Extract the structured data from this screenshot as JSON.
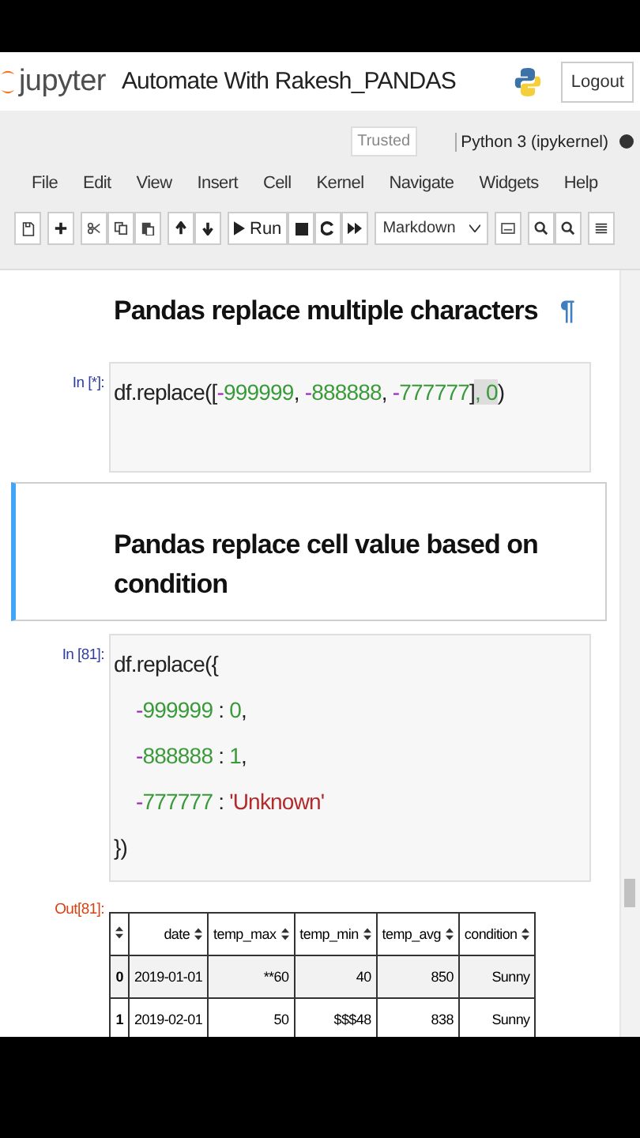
{
  "header": {
    "logo_text": "jupyter",
    "notebook_title": "Automate With Rakesh_PANDAS",
    "logout": "Logout"
  },
  "kernel_bar": {
    "trusted": "Trusted",
    "kernel": "Python 3 (ipykernel)",
    "busy": true
  },
  "menu": [
    "File",
    "Edit",
    "View",
    "Insert",
    "Cell",
    "Kernel",
    "Navigate",
    "Widgets",
    "Help"
  ],
  "toolbar": {
    "run": "Run",
    "cell_type": "Markdown"
  },
  "cells": [
    {
      "kind": "markdown",
      "selected": false,
      "heading": "Pandas replace multiple characters",
      "anchor": "¶"
    },
    {
      "kind": "code",
      "prompt": "In [*]:",
      "lines": [
        {
          "indented": false,
          "tokens": [
            {
              "kind": "name",
              "text": "df.replace(["
            },
            {
              "kind": "op",
              "text": "-"
            },
            {
              "kind": "num",
              "text": "999999"
            },
            {
              "kind": "name",
              "text": ", "
            },
            {
              "kind": "op",
              "text": "-"
            },
            {
              "kind": "num",
              "text": "888888"
            },
            {
              "kind": "name",
              "text": ", "
            },
            {
              "kind": "op",
              "text": "-"
            },
            {
              "kind": "num",
              "text": "777777"
            },
            {
              "kind": "name",
              "text": "]"
            },
            {
              "kind": "match",
              "text": ", 0"
            },
            {
              "kind": "name",
              "text": ")"
            }
          ]
        }
      ]
    },
    {
      "kind": "markdown",
      "selected": true,
      "heading": "Pandas replace cell value based on condition"
    },
    {
      "kind": "code",
      "prompt": "In [81]:",
      "lines": [
        {
          "indented": false,
          "tokens": [
            {
              "kind": "name",
              "text": "df.replace({"
            }
          ]
        },
        {
          "indented": true,
          "tokens": [
            {
              "kind": "op",
              "text": "-"
            },
            {
              "kind": "num",
              "text": "999999"
            },
            {
              "kind": "name",
              "text": " : "
            },
            {
              "kind": "num",
              "text": "0"
            },
            {
              "kind": "name",
              "text": ","
            }
          ]
        },
        {
          "indented": true,
          "tokens": [
            {
              "kind": "op",
              "text": "-"
            },
            {
              "kind": "num",
              "text": "888888"
            },
            {
              "kind": "name",
              "text": " : "
            },
            {
              "kind": "num",
              "text": "1"
            },
            {
              "kind": "name",
              "text": ","
            }
          ]
        },
        {
          "indented": true,
          "tokens": [
            {
              "kind": "op",
              "text": "-"
            },
            {
              "kind": "num",
              "text": "777777"
            },
            {
              "kind": "name",
              "text": " : "
            },
            {
              "kind": "str",
              "text": "'Unknown'"
            }
          ]
        },
        {
          "indented": false,
          "tokens": [
            {
              "kind": "name",
              "text": "})"
            }
          ]
        }
      ],
      "output": {
        "prompt": "Out[81]:",
        "columns": [
          "",
          "date",
          "temp_max",
          "temp_min",
          "temp_avg",
          "condition"
        ],
        "rows": [
          [
            "0",
            "2019-01-01",
            "**60",
            "40",
            "850",
            "Sunny"
          ],
          [
            "1",
            "2019-02-01",
            "50",
            "$$$48",
            "838",
            "Sunny"
          ]
        ]
      }
    }
  ]
}
